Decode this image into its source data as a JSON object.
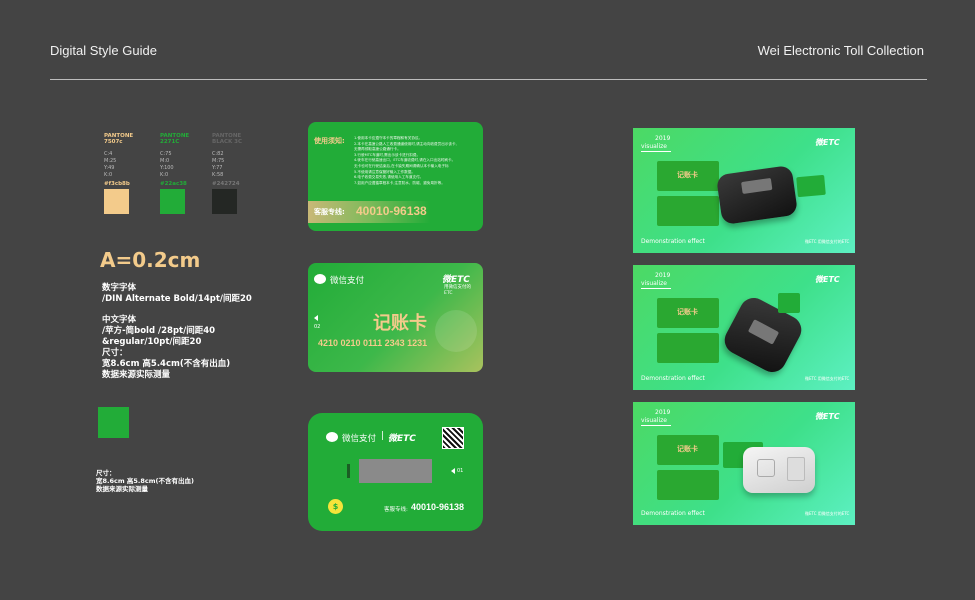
{
  "header": {
    "left_title": "Digital Style Guide",
    "right_title": "Wei Electronic Toll Collection"
  },
  "swatches": [
    {
      "brand": "PANTONE",
      "code": "7507c",
      "cmyk": [
        "C:4",
        "M:25",
        "Y:49",
        "K:0"
      ],
      "hex": "#f3cb8b",
      "color": "#f3cb8b",
      "name_color": "#f3cb8b"
    },
    {
      "brand": "PANTONE",
      "code": "2271C",
      "cmyk": [
        "C:75",
        "M:0",
        "Y:100",
        "K:0"
      ],
      "hex": "#22ac38",
      "color": "#22ac38",
      "name_color": "#22ac38"
    },
    {
      "brand": "PANTONE",
      "code": "BLACK 3C",
      "cmyk": [
        "C:82",
        "M:75",
        "Y:77",
        "K:58"
      ],
      "hex": "#242724",
      "color": "#242724",
      "name_color": "#555555"
    }
  ],
  "spec": {
    "corner_radius": "A=0.2cm",
    "lines": [
      "数字字体",
      "/DIN Alternate Bold/14pt/间距20",
      "",
      "中文字体",
      "/苹方-简bold /28pt/间距40",
      "&regular/10pt/间距20",
      "尺寸：",
      "宽8.6cm 高5.4cm(不含有出血)",
      "数据来源实际测量"
    ],
    "lines2": [
      "尺寸：",
      "宽8.6cm 高5.8cm(不含有出血)",
      "数据来源实际测量"
    ]
  },
  "card1": {
    "title": "使用须知:",
    "items": [
      "1.使用本卡应遵守本卡的章程和有关协议。",
      "2.本卡在高速公路人工收费通道使用时,请主动向收费员出示该卡,",
      "  无需再领取高速公路通行卡。",
      "3.行驶MTC车道时,需出示该卡进行扣费。",
      "4.驶车在行驶高速出口、ETC车道收费时,请在入口出站时刷卡。",
      "  无卡也可在行驶结束后,在卡缺失期间请确认本卡输入电子标",
      "5.不使用请注意保管好输入工作数据。",
      "6.电子收费交易失败,请使用人工车道支付。",
      "7.如用户应遵循章程本卡,注意防水、防磁、避免弯折等。"
    ],
    "hotline_label": "客服专线:",
    "hotline": "40010-96138"
  },
  "card2": {
    "wechat_pay": "微信支付",
    "logo": "微ETC",
    "logo_sub1": "用微信支付的",
    "logo_sub2": "ETC",
    "chip_no": "02",
    "title": "记账卡",
    "number": "4210 0210 0111 2343 1231"
  },
  "card3": {
    "wechat_pay": "微信支付",
    "logo": "微ETC",
    "slot_no": "01",
    "coin": "$",
    "hotline_label": "客服专线:",
    "hotline": "40010-96138"
  },
  "previews": [
    {
      "year": "2019",
      "word": "visualize",
      "logo": "微ETC",
      "caption": "Demonstration effect",
      "footer": "微ETC 用微信支付的ETC",
      "card_title": "记账卡"
    },
    {
      "year": "2019",
      "word": "visualize",
      "logo": "微ETC",
      "caption": "Demonstration effect",
      "footer": "微ETC 用微信支付的ETC",
      "card_title": "记账卡"
    },
    {
      "year": "2019",
      "word": "visualize",
      "logo": "微ETC",
      "caption": "Demonstration effect",
      "footer": "微ETC 用微信支付的ETC",
      "card_title": "记账卡"
    }
  ]
}
